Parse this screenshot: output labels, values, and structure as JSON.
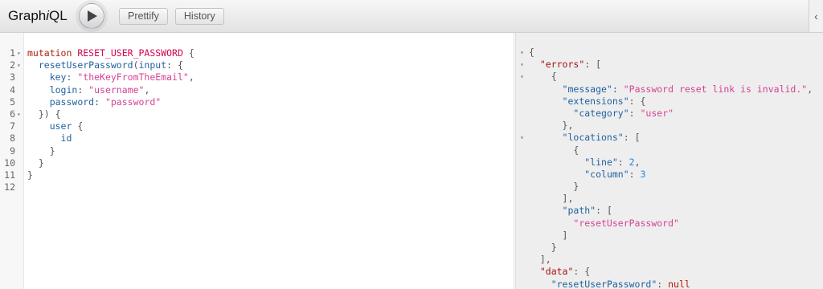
{
  "app": {
    "title_prefix": "Graph",
    "title_italic": "i",
    "title_suffix": "QL"
  },
  "toolbar": {
    "execute_icon": "play-icon",
    "prettify_label": "Prettify",
    "history_label": "History",
    "docs_icon": "chevron-left-icon"
  },
  "colors": {
    "keyword": "#B11A04",
    "definition": "#D2054E",
    "property": "#1F61A0",
    "string": "#D64292",
    "number": "#2882F9",
    "result_key": "#A11"
  },
  "editor": {
    "lines": [
      {
        "n": "1",
        "fold": true,
        "tokens": [
          [
            "kw",
            "mutation"
          ],
          [
            "punc",
            " "
          ],
          [
            "def",
            "RESET_USER_PASSWORD"
          ],
          [
            "punc",
            " {"
          ]
        ]
      },
      {
        "n": "2",
        "fold": true,
        "tokens": [
          [
            "punc",
            "  "
          ],
          [
            "prop",
            "resetUserPassword"
          ],
          [
            "punc",
            "("
          ],
          [
            "prop",
            "input"
          ],
          [
            "punc",
            ": {"
          ]
        ]
      },
      {
        "n": "3",
        "fold": false,
        "tokens": [
          [
            "punc",
            "    "
          ],
          [
            "prop",
            "key"
          ],
          [
            "punc",
            ": "
          ],
          [
            "str",
            "\"theKeyFromTheEmail\""
          ],
          [
            "punc",
            ","
          ]
        ]
      },
      {
        "n": "4",
        "fold": false,
        "tokens": [
          [
            "punc",
            "    "
          ],
          [
            "prop",
            "login"
          ],
          [
            "punc",
            ": "
          ],
          [
            "str",
            "\"username\""
          ],
          [
            "punc",
            ","
          ]
        ]
      },
      {
        "n": "5",
        "fold": false,
        "tokens": [
          [
            "punc",
            "    "
          ],
          [
            "prop",
            "password"
          ],
          [
            "punc",
            ": "
          ],
          [
            "str",
            "\"password\""
          ]
        ]
      },
      {
        "n": "6",
        "fold": true,
        "tokens": [
          [
            "punc",
            "  }) {"
          ]
        ]
      },
      {
        "n": "7",
        "fold": false,
        "tokens": [
          [
            "punc",
            "    "
          ],
          [
            "prop",
            "user"
          ],
          [
            "punc",
            " {"
          ]
        ]
      },
      {
        "n": "8",
        "fold": false,
        "tokens": [
          [
            "punc",
            "      "
          ],
          [
            "prop",
            "id"
          ]
        ]
      },
      {
        "n": "9",
        "fold": false,
        "tokens": [
          [
            "punc",
            "    }"
          ]
        ]
      },
      {
        "n": "10",
        "fold": false,
        "tokens": [
          [
            "punc",
            "  }"
          ]
        ]
      },
      {
        "n": "11",
        "fold": false,
        "tokens": [
          [
            "punc",
            "}"
          ]
        ]
      },
      {
        "n": "12",
        "fold": false,
        "tokens": []
      }
    ]
  },
  "results": {
    "lines": [
      {
        "fold": true,
        "tokens": [
          [
            "punc",
            "{"
          ]
        ]
      },
      {
        "fold": true,
        "tokens": [
          [
            "punc",
            "  "
          ],
          [
            "rkey",
            "\"errors\""
          ],
          [
            "punc",
            ": ["
          ]
        ]
      },
      {
        "fold": true,
        "tokens": [
          [
            "punc",
            "    {"
          ]
        ]
      },
      {
        "fold": false,
        "tokens": [
          [
            "punc",
            "      "
          ],
          [
            "prop",
            "\"message\""
          ],
          [
            "punc",
            ": "
          ],
          [
            "str",
            "\"Password reset link is invalid.\""
          ],
          [
            "punc",
            ","
          ]
        ]
      },
      {
        "fold": false,
        "tokens": [
          [
            "punc",
            "      "
          ],
          [
            "prop",
            "\"extensions\""
          ],
          [
            "punc",
            ": {"
          ]
        ]
      },
      {
        "fold": false,
        "tokens": [
          [
            "punc",
            "        "
          ],
          [
            "prop",
            "\"category\""
          ],
          [
            "punc",
            ": "
          ],
          [
            "str",
            "\"user\""
          ]
        ]
      },
      {
        "fold": false,
        "tokens": [
          [
            "punc",
            "      },"
          ]
        ]
      },
      {
        "fold": true,
        "tokens": [
          [
            "punc",
            "      "
          ],
          [
            "prop",
            "\"locations\""
          ],
          [
            "punc",
            ": ["
          ]
        ]
      },
      {
        "fold": false,
        "tokens": [
          [
            "punc",
            "        {"
          ]
        ]
      },
      {
        "fold": false,
        "tokens": [
          [
            "punc",
            "          "
          ],
          [
            "prop",
            "\"line\""
          ],
          [
            "punc",
            ": "
          ],
          [
            "num",
            "2"
          ],
          [
            "punc",
            ","
          ]
        ]
      },
      {
        "fold": false,
        "tokens": [
          [
            "punc",
            "          "
          ],
          [
            "prop",
            "\"column\""
          ],
          [
            "punc",
            ": "
          ],
          [
            "num",
            "3"
          ]
        ]
      },
      {
        "fold": false,
        "tokens": [
          [
            "punc",
            "        }"
          ]
        ]
      },
      {
        "fold": false,
        "tokens": [
          [
            "punc",
            "      ],"
          ]
        ]
      },
      {
        "fold": false,
        "tokens": [
          [
            "punc",
            "      "
          ],
          [
            "prop",
            "\"path\""
          ],
          [
            "punc",
            ": ["
          ]
        ]
      },
      {
        "fold": false,
        "tokens": [
          [
            "punc",
            "        "
          ],
          [
            "str",
            "\"resetUserPassword\""
          ]
        ]
      },
      {
        "fold": false,
        "tokens": [
          [
            "punc",
            "      ]"
          ]
        ]
      },
      {
        "fold": false,
        "tokens": [
          [
            "punc",
            "    }"
          ]
        ]
      },
      {
        "fold": false,
        "tokens": [
          [
            "punc",
            "  ],"
          ]
        ]
      },
      {
        "fold": false,
        "tokens": [
          [
            "punc",
            "  "
          ],
          [
            "rkey",
            "\"data\""
          ],
          [
            "punc",
            ": {"
          ]
        ]
      },
      {
        "fold": false,
        "tokens": [
          [
            "punc",
            "    "
          ],
          [
            "prop",
            "\"resetUserPassword\""
          ],
          [
            "punc",
            ": "
          ],
          [
            "rnull",
            "null"
          ]
        ]
      },
      {
        "fold": false,
        "tokens": [
          [
            "punc",
            "  }"
          ]
        ]
      }
    ]
  }
}
